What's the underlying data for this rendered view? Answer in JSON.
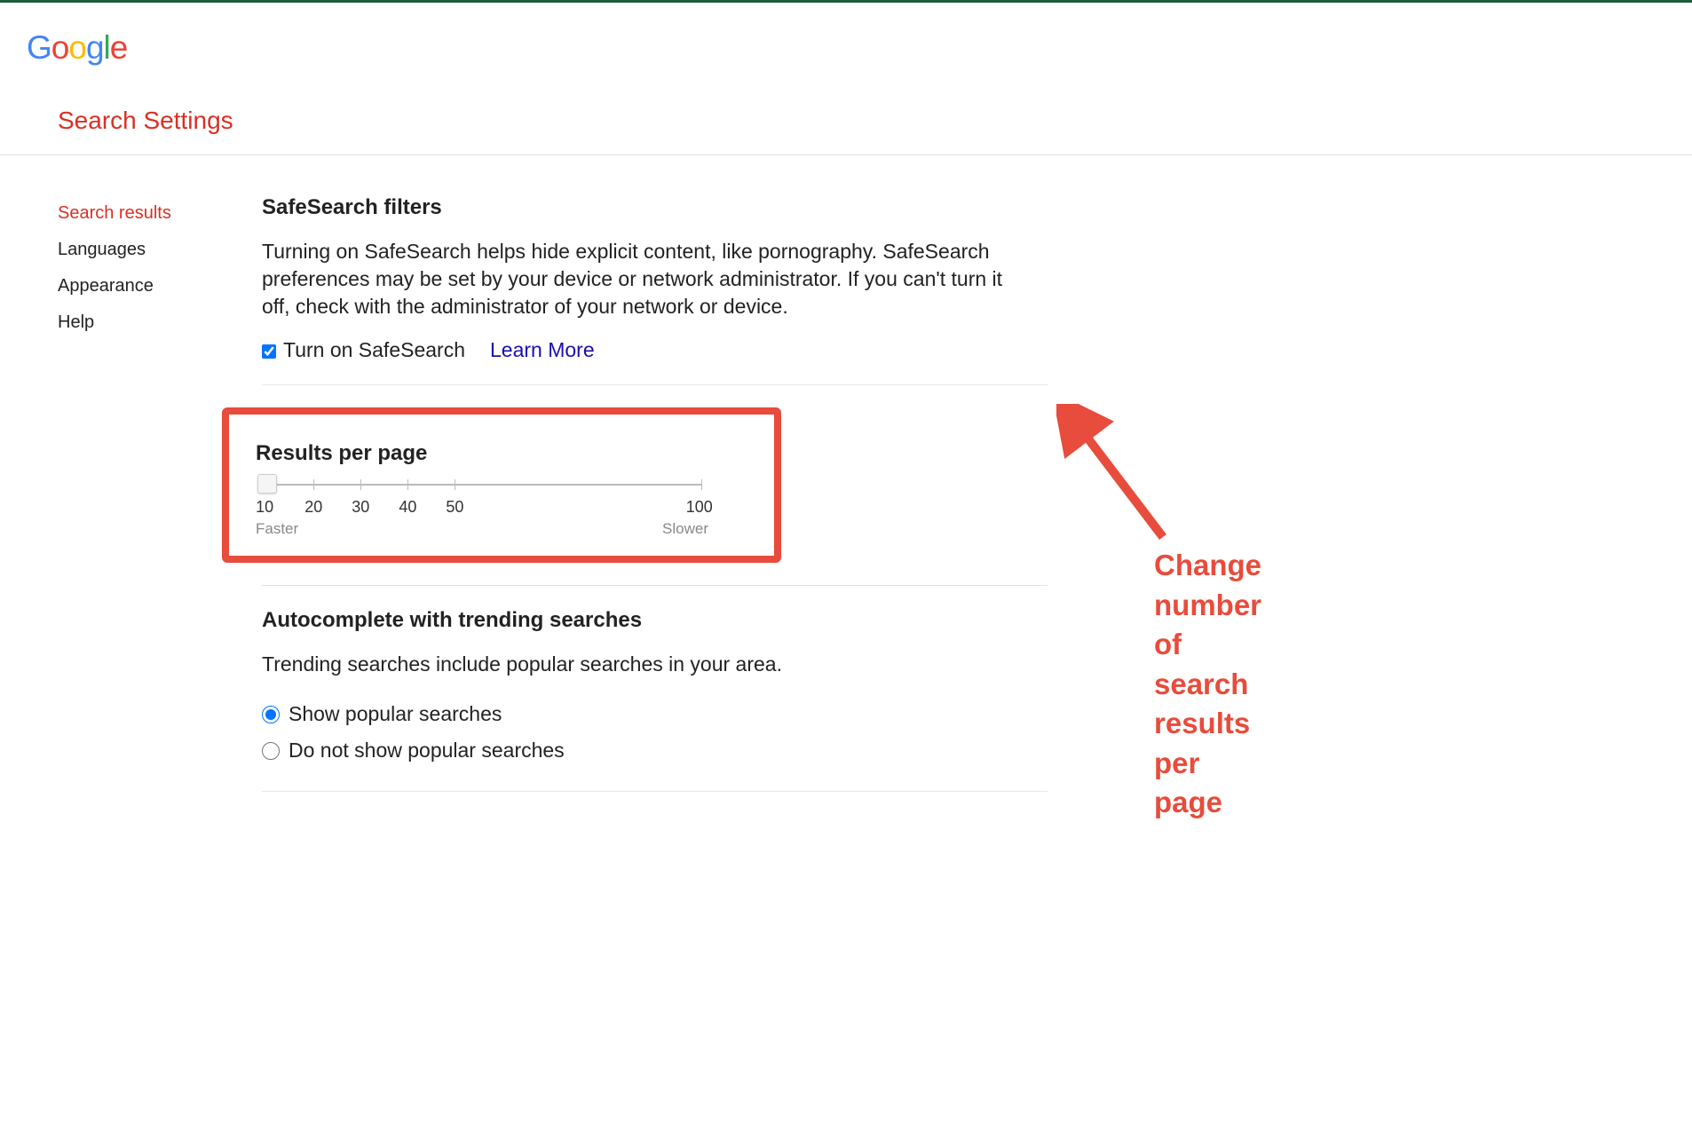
{
  "logo_text": "Google",
  "page_title": "Search Settings",
  "sidebar": {
    "items": [
      {
        "label": "Search results",
        "active": true
      },
      {
        "label": "Languages",
        "active": false
      },
      {
        "label": "Appearance",
        "active": false
      },
      {
        "label": "Help",
        "active": false
      }
    ]
  },
  "safesearch": {
    "title": "SafeSearch filters",
    "desc": "Turning on SafeSearch helps hide explicit content, like pornography. SafeSearch preferences may be set by your device or network administrator. If you can't turn it off, check with the administrator of your network or device.",
    "checkbox_label": "Turn on SafeSearch",
    "checked": true,
    "learn_more": "Learn More"
  },
  "results_per_page": {
    "title": "Results per page",
    "ticks": [
      "10",
      "20",
      "30",
      "40",
      "50",
      "100"
    ],
    "left_label": "Faster",
    "right_label": "Slower",
    "current_value": "10"
  },
  "autocomplete": {
    "title": "Autocomplete with trending searches",
    "desc": "Trending searches include popular searches in your area.",
    "options": [
      {
        "label": "Show popular searches",
        "selected": true
      },
      {
        "label": "Do not show popular searches",
        "selected": false
      }
    ]
  },
  "annotation": {
    "text": "Change number of search results per page",
    "color": "#e74c3c"
  }
}
